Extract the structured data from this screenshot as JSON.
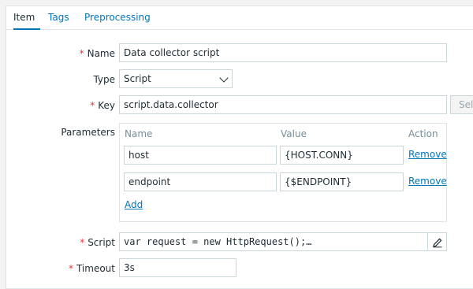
{
  "tabs": [
    {
      "label": "Item"
    },
    {
      "label": "Tags"
    },
    {
      "label": "Preprocessing"
    }
  ],
  "form": {
    "name": {
      "label": "Name",
      "value": "Data collector script"
    },
    "type": {
      "label": "Type",
      "value": "Script"
    },
    "key": {
      "label": "Key",
      "value": "script.data.collector",
      "select_button": "Select"
    },
    "parameters": {
      "label": "Parameters",
      "headers": {
        "name": "Name",
        "value": "Value",
        "action": "Action"
      },
      "rows": [
        {
          "name": "host",
          "value": "{HOST.CONN}",
          "action": "Remove"
        },
        {
          "name": "endpoint",
          "value": "{$ENDPOINT}",
          "action": "Remove"
        }
      ],
      "add_label": "Add"
    },
    "script": {
      "label": "Script",
      "value": "var request = new HttpRequest();…"
    },
    "timeout": {
      "label": "Timeout",
      "value": "3s"
    }
  },
  "colors": {
    "accent": "#0275b8",
    "required": "#e33734"
  },
  "icons": {
    "edit": "pencil-icon",
    "dropdown": "chevron-down-icon"
  }
}
